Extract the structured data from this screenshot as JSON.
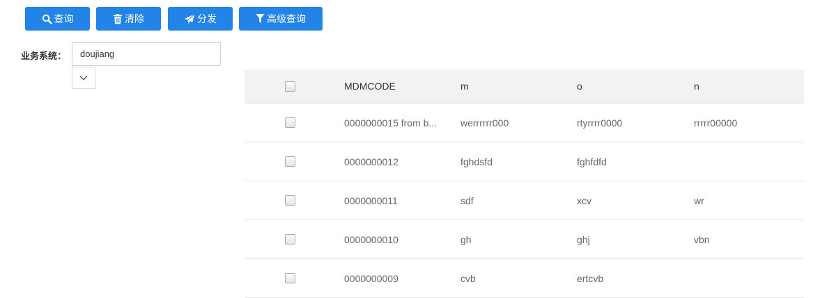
{
  "toolbar": {
    "query_label": "查询",
    "clear_label": "清除",
    "distribute_label": "分发",
    "advanced_query_label": "高级查询"
  },
  "filter": {
    "label": "业务系统：",
    "value": "doujiang"
  },
  "table": {
    "columns": [
      "MDMCODE",
      "m",
      "o",
      "n"
    ],
    "rows": [
      {
        "mdmcode": "0000000015 from b...",
        "m": "werrrrrr000",
        "o": "rtyrrrr0000",
        "n": "rrrrr00000"
      },
      {
        "mdmcode": "0000000012",
        "m": "fghdsfd",
        "o": "fghfdfd",
        "n": ""
      },
      {
        "mdmcode": "0000000011",
        "m": "sdf",
        "o": "xcv",
        "n": "wr"
      },
      {
        "mdmcode": "0000000010",
        "m": "gh",
        "o": "ghj",
        "n": "vbn"
      },
      {
        "mdmcode": "0000000009",
        "m": "cvb",
        "o": "ertcvb",
        "n": ""
      }
    ]
  },
  "colors": {
    "button": "#2384e8",
    "header_bg": "#f2f2f2"
  },
  "icons": {
    "query": "search-icon",
    "clear": "trash-icon",
    "distribute": "send-icon",
    "advanced_query": "filter-icon",
    "dropdown": "chevron-down-icon"
  }
}
